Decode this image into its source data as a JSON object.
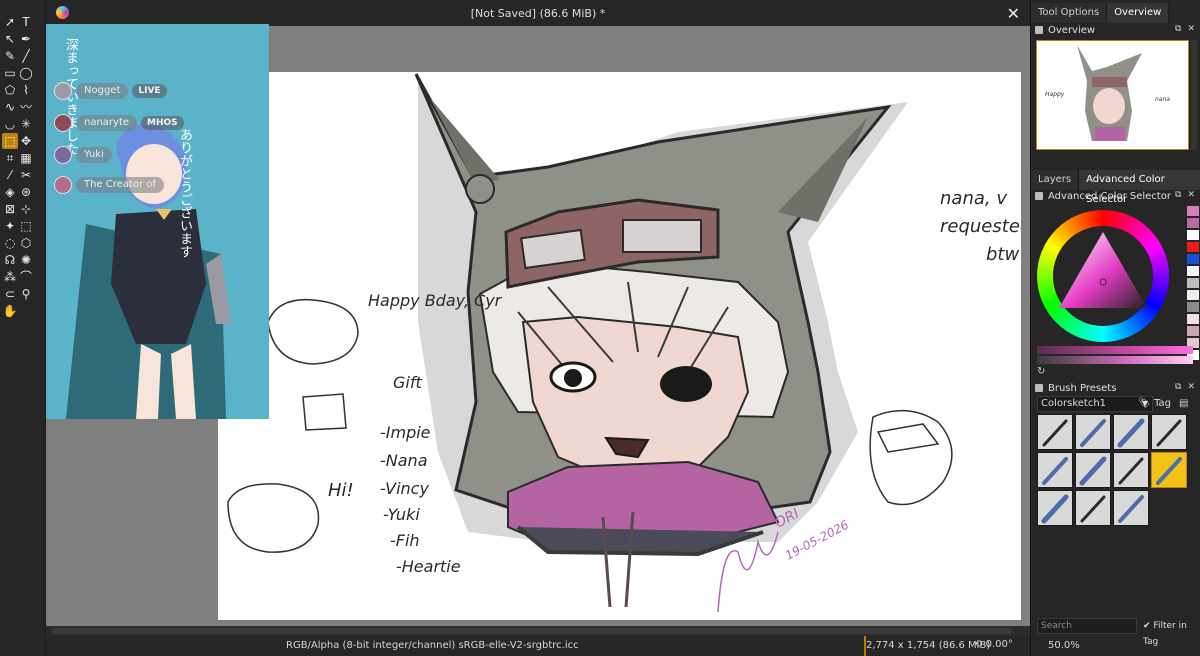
{
  "window": {
    "title": "[Not Saved]  (86.6 MiB) *"
  },
  "toolbox": {
    "tools": [
      {
        "name": "select-shapes-tool",
        "glyph": "➚"
      },
      {
        "name": "text-tool",
        "glyph": "T"
      },
      {
        "name": "edit-shapes-tool",
        "glyph": "↖"
      },
      {
        "name": "calligraphy-tool",
        "glyph": "✒"
      },
      {
        "name": "freehand-brush-tool",
        "glyph": "✎"
      },
      {
        "name": "line-tool",
        "glyph": "╱"
      },
      {
        "name": "rectangle-tool",
        "glyph": "▭"
      },
      {
        "name": "ellipse-tool",
        "glyph": "◯"
      },
      {
        "name": "polygon-tool",
        "glyph": "⬠"
      },
      {
        "name": "polyline-tool",
        "glyph": "⌇"
      },
      {
        "name": "bezier-tool",
        "glyph": "∿"
      },
      {
        "name": "freehand-path-tool",
        "glyph": "〰"
      },
      {
        "name": "dynamic-brush-tool",
        "glyph": "◡"
      },
      {
        "name": "multibrush-tool",
        "glyph": "✳"
      },
      {
        "name": "transform-tool",
        "glyph": "⬚"
      },
      {
        "name": "move-tool",
        "glyph": "✥"
      },
      {
        "name": "crop-tool",
        "glyph": "⌗"
      },
      {
        "name": "gradient-tool",
        "glyph": "▦"
      },
      {
        "name": "color-picker-tool",
        "glyph": "⁄"
      },
      {
        "name": "smart-patch-tool",
        "glyph": "✂"
      },
      {
        "name": "fill-tool",
        "glyph": "◈"
      },
      {
        "name": "enclose-fill-tool",
        "glyph": "⊛"
      },
      {
        "name": "assistant-tool",
        "glyph": "⊠"
      },
      {
        "name": "measure-tool",
        "glyph": "⊹"
      },
      {
        "name": "reference-tool",
        "glyph": "✦"
      },
      {
        "name": "rect-select-tool",
        "glyph": "⬚"
      },
      {
        "name": "ellipse-select-tool",
        "glyph": "◌"
      },
      {
        "name": "polygon-select-tool",
        "glyph": "⬡"
      },
      {
        "name": "freehand-select-tool",
        "glyph": "☊"
      },
      {
        "name": "contiguous-select-tool",
        "glyph": "✺"
      },
      {
        "name": "similar-select-tool",
        "glyph": "⁂"
      },
      {
        "name": "bezier-select-tool",
        "glyph": "⌒"
      },
      {
        "name": "magnetic-select-tool",
        "glyph": "⊂"
      },
      {
        "name": "zoom-tool",
        "glyph": "⚲"
      },
      {
        "name": "pan-tool",
        "glyph": "✋"
      }
    ]
  },
  "stream": {
    "jp_col1": "深まっていきました",
    "jp_col2": "ありがとうございます",
    "chat": [
      {
        "name": "Nogget",
        "badge": "LIVE"
      },
      {
        "name": "nanaryte",
        "badge": "MHOS"
      },
      {
        "name": "Yuki",
        "badge": ""
      },
      {
        "name": "The Creator of",
        "badge": ""
      }
    ]
  },
  "canvas": {
    "sketch_texts": {
      "bday": "Happy Bday, Cyr",
      "gift": "Gift",
      "hi": "Hi!",
      "names": [
        "-Impie",
        "-Nana",
        "-Vincy",
        "-Yuki",
        "-Fih",
        "-Heartie"
      ],
      "note1": "nana, v",
      "note2": "requested",
      "note3": "btw",
      "signature_date": "19-05-2026",
      "signature_name": "ORI"
    }
  },
  "dock": {
    "top_tabs": [
      "Tool Options",
      "Overview"
    ],
    "overview_title": "Overview",
    "mid_tabs": [
      "Layers",
      "Advanced Color Selector"
    ],
    "color_title": "Advanced Color Selector",
    "swatches": [
      "#d97fb8",
      "#b56c9e",
      "#ffffff",
      "#e0201c",
      "#1a4fd6",
      "#f5f5f5",
      "#bdbdbd",
      "#ededed",
      "#8c8c8c",
      "#f0e0e8",
      "#c9a8b8",
      "#e5c6d7",
      "#ffffff"
    ],
    "brush_title": "Brush Presets",
    "preset_name": "Colorsketch1",
    "tag_label": "Tag",
    "search_placeholder": "Search",
    "filter_label": "Filter in Tag"
  },
  "status": {
    "format": "RGB/Alpha (8-bit integer/channel)  sRGB-elle-V2-srgbtrc.icc",
    "size": "2,774 x 1,754 (86.6 MiB)",
    "rotation": "0.00°",
    "zoom": "50.0%"
  }
}
